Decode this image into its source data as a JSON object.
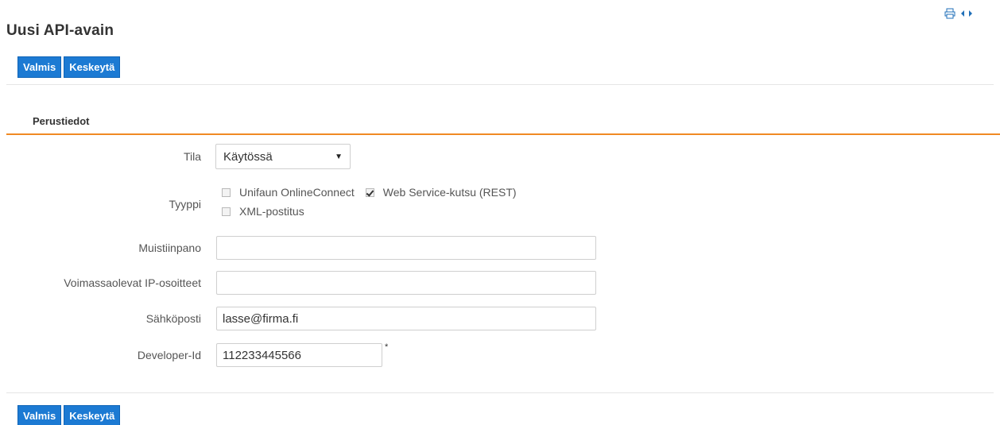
{
  "header": {
    "title": "Uusi API-avain",
    "icons": [
      "print-icon",
      "expand-icon"
    ]
  },
  "toolbar": {
    "done_label": "Valmis",
    "cancel_label": "Keskeytä"
  },
  "section": {
    "title": "Perustiedot"
  },
  "form": {
    "status": {
      "label": "Tila",
      "value": "Käytössä"
    },
    "type": {
      "label": "Tyyppi",
      "options": [
        {
          "label": "Unifaun OnlineConnect",
          "checked": false
        },
        {
          "label": "Web Service-kutsu (REST)",
          "checked": true
        },
        {
          "label": "XML-postitus",
          "checked": false
        }
      ]
    },
    "note": {
      "label": "Muistiinpano",
      "value": ""
    },
    "ip": {
      "label": "Voimassaolevat IP-osoitteet",
      "value": ""
    },
    "email": {
      "label": "Sähköposti",
      "value": "lasse@firma.fi"
    },
    "developer_id": {
      "label": "Developer-Id",
      "value": "112233445566",
      "required_mark": "*"
    }
  },
  "colors": {
    "primary": "#1c7ad3",
    "accent": "#f08a24",
    "text": "#333333"
  }
}
